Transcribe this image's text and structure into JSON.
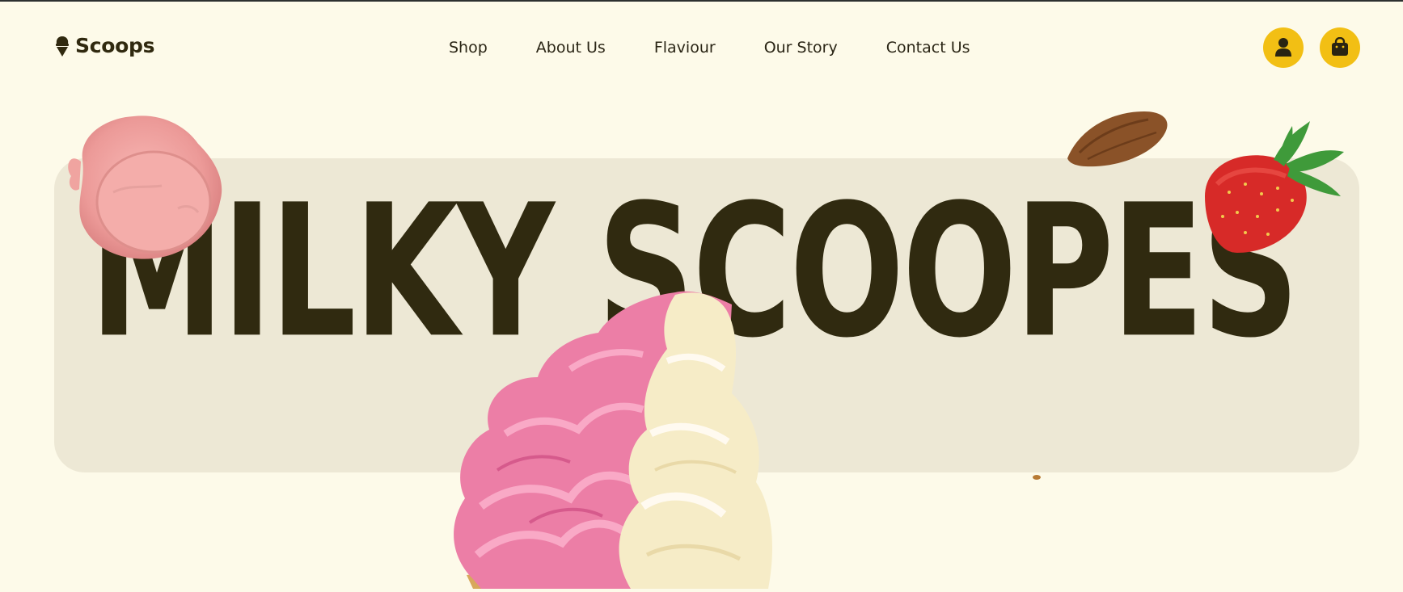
{
  "brand": {
    "name": "Scoops",
    "icon": "ice-cream-icon"
  },
  "nav": {
    "items": [
      {
        "label": "Shop"
      },
      {
        "label": "About Us"
      },
      {
        "label": "Flaviour"
      },
      {
        "label": "Our Story"
      },
      {
        "label": "Contact Us"
      }
    ],
    "account_icon": "user-icon",
    "cart_icon": "shopping-bag-icon"
  },
  "hero": {
    "title": "MILKY SCOOPES",
    "images": [
      "strawberry-ice-cream-scoop",
      "almond",
      "strawberry",
      "strawberry-vanilla-swirl-cone"
    ]
  },
  "colors": {
    "background": "#fdfae9",
    "panel": "#ede8d5",
    "text": "#302a10",
    "accent": "#f2bf14"
  }
}
